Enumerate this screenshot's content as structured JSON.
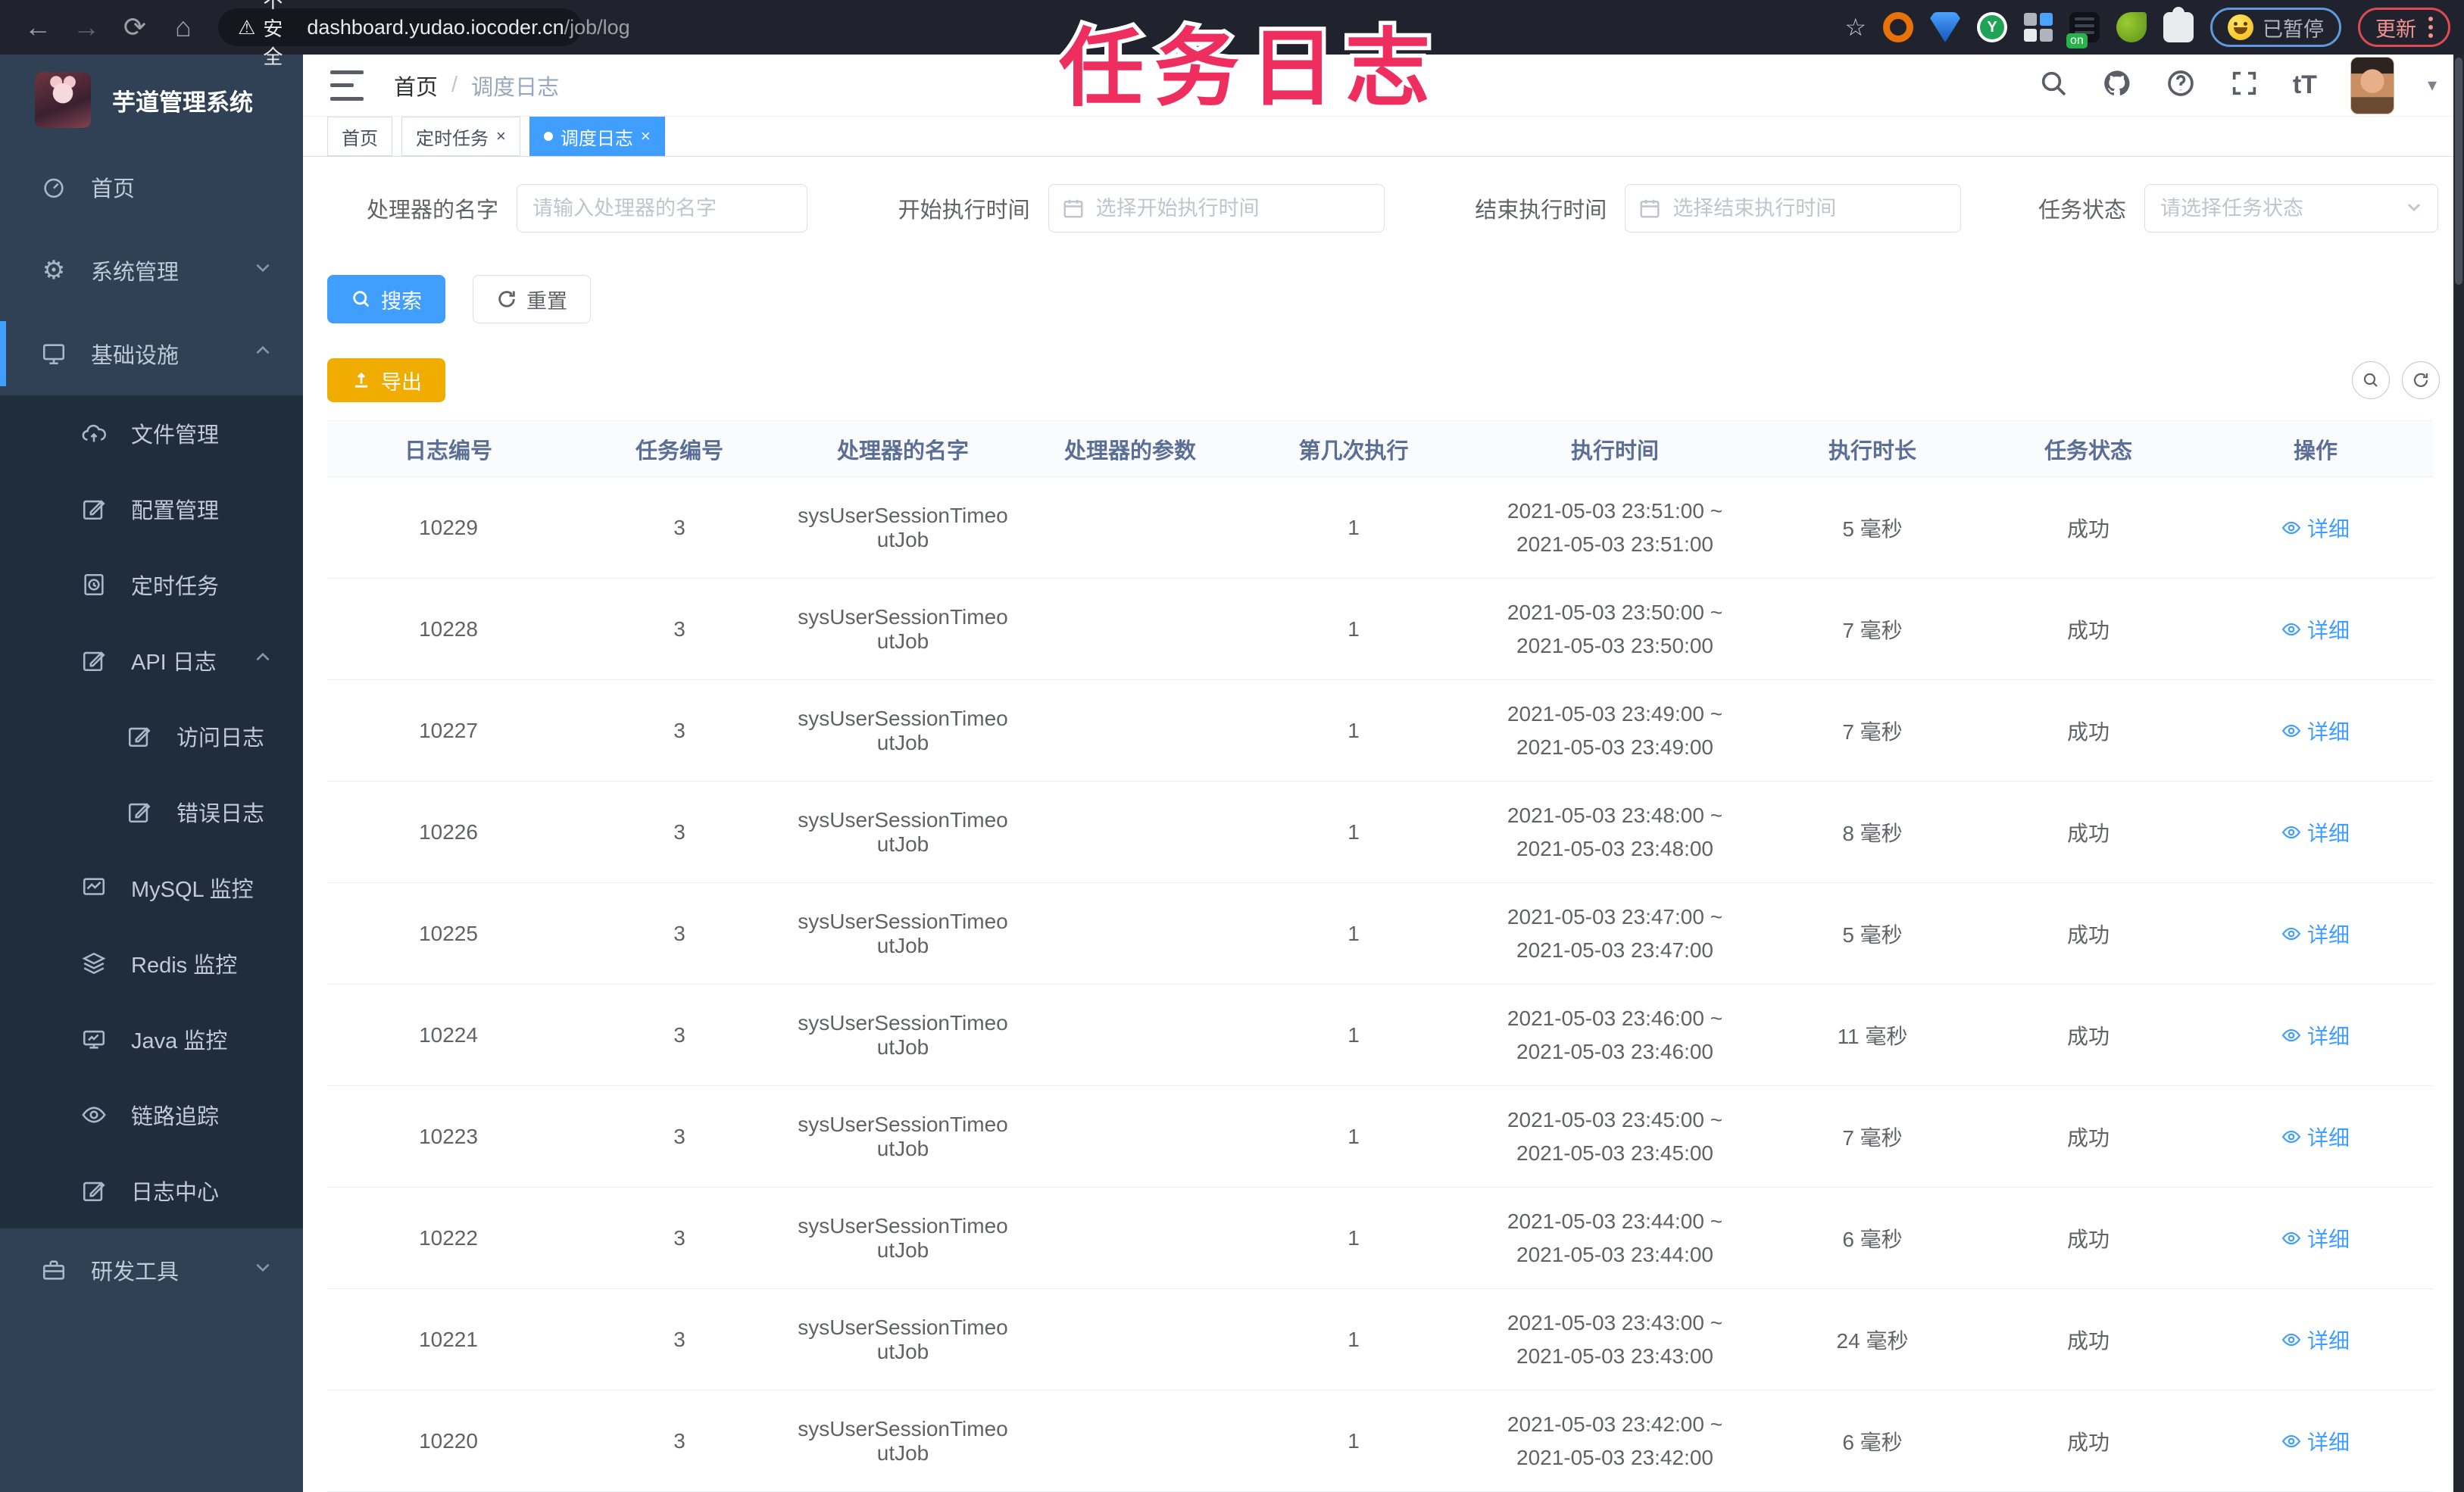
{
  "browser": {
    "security_label": "不安全",
    "url_host": "dashboard.yudao.iocoder.cn",
    "url_path": "/job/log",
    "paused_label": "已暂停",
    "update_label": "更新"
  },
  "annotation": {
    "title": "任务日志",
    "color": "#ee2e5e"
  },
  "sidebar": {
    "app_title": "芋道管理系统",
    "items": [
      {
        "label": "首页"
      },
      {
        "label": "系统管理"
      },
      {
        "label": "基础设施"
      },
      {
        "label": "文件管理"
      },
      {
        "label": "配置管理"
      },
      {
        "label": "定时任务"
      },
      {
        "label": "API 日志"
      },
      {
        "label": "访问日志"
      },
      {
        "label": "错误日志"
      },
      {
        "label": "MySQL 监控"
      },
      {
        "label": "Redis 监控"
      },
      {
        "label": "Java 监控"
      },
      {
        "label": "链路追踪"
      },
      {
        "label": "日志中心"
      },
      {
        "label": "研发工具"
      }
    ]
  },
  "header": {
    "breadcrumb_home": "首页",
    "breadcrumb_current": "调度日志"
  },
  "tabs": [
    {
      "label": "首页"
    },
    {
      "label": "定时任务"
    },
    {
      "label": "调度日志"
    }
  ],
  "filters": {
    "handler_label": "处理器的名字",
    "handler_placeholder": "请输入处理器的名字",
    "start_label": "开始执行时间",
    "start_placeholder": "选择开始执行时间",
    "end_label": "结束执行时间",
    "end_placeholder": "选择结束执行时间",
    "status_label": "任务状态",
    "status_placeholder": "请选择任务状态",
    "search_label": "搜索",
    "reset_label": "重置",
    "export_label": "导出"
  },
  "table": {
    "headers": [
      "日志编号",
      "任务编号",
      "处理器的名字",
      "处理器的参数",
      "第几次执行",
      "执行时间",
      "执行时长",
      "任务状态",
      "操作"
    ],
    "detail_label": "详细",
    "rows": [
      {
        "id": "10229",
        "job_id": "3",
        "handler": "sysUserSessionTimeoutJob",
        "param": "",
        "index": "1",
        "time": "2021-05-03 23:51:00 ~\n2021-05-03 23:51:00",
        "duration": "5 毫秒",
        "status": "成功"
      },
      {
        "id": "10228",
        "job_id": "3",
        "handler": "sysUserSessionTimeoutJob",
        "param": "",
        "index": "1",
        "time": "2021-05-03 23:50:00 ~\n2021-05-03 23:50:00",
        "duration": "7 毫秒",
        "status": "成功"
      },
      {
        "id": "10227",
        "job_id": "3",
        "handler": "sysUserSessionTimeoutJob",
        "param": "",
        "index": "1",
        "time": "2021-05-03 23:49:00 ~\n2021-05-03 23:49:00",
        "duration": "7 毫秒",
        "status": "成功"
      },
      {
        "id": "10226",
        "job_id": "3",
        "handler": "sysUserSessionTimeoutJob",
        "param": "",
        "index": "1",
        "time": "2021-05-03 23:48:00 ~\n2021-05-03 23:48:00",
        "duration": "8 毫秒",
        "status": "成功"
      },
      {
        "id": "10225",
        "job_id": "3",
        "handler": "sysUserSessionTimeoutJob",
        "param": "",
        "index": "1",
        "time": "2021-05-03 23:47:00 ~\n2021-05-03 23:47:00",
        "duration": "5 毫秒",
        "status": "成功"
      },
      {
        "id": "10224",
        "job_id": "3",
        "handler": "sysUserSessionTimeoutJob",
        "param": "",
        "index": "1",
        "time": "2021-05-03 23:46:00 ~\n2021-05-03 23:46:00",
        "duration": "11 毫秒",
        "status": "成功"
      },
      {
        "id": "10223",
        "job_id": "3",
        "handler": "sysUserSessionTimeoutJob",
        "param": "",
        "index": "1",
        "time": "2021-05-03 23:45:00 ~\n2021-05-03 23:45:00",
        "duration": "7 毫秒",
        "status": "成功"
      },
      {
        "id": "10222",
        "job_id": "3",
        "handler": "sysUserSessionTimeoutJob",
        "param": "",
        "index": "1",
        "time": "2021-05-03 23:44:00 ~\n2021-05-03 23:44:00",
        "duration": "6 毫秒",
        "status": "成功"
      },
      {
        "id": "10221",
        "job_id": "3",
        "handler": "sysUserSessionTimeoutJob",
        "param": "",
        "index": "1",
        "time": "2021-05-03 23:43:00 ~\n2021-05-03 23:43:00",
        "duration": "24 毫秒",
        "status": "成功"
      },
      {
        "id": "10220",
        "job_id": "3",
        "handler": "sysUserSessionTimeoutJob",
        "param": "",
        "index": "1",
        "time": "2021-05-03 23:42:00 ~\n2021-05-03 23:42:00",
        "duration": "6 毫秒",
        "status": "成功"
      }
    ]
  },
  "colors": {
    "accent_blue": "#409eff",
    "warning_yellow": "#f0ad00",
    "sidebar_bg": "#304156",
    "submenu_bg": "#1f2d3d",
    "annotation_pink": "#ee2e5e"
  }
}
